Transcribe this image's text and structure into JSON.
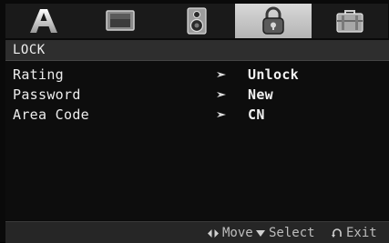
{
  "tabs": [
    {
      "icon": "language-a-icon",
      "active": false
    },
    {
      "icon": "display-icon",
      "active": false
    },
    {
      "icon": "speaker-icon",
      "active": false
    },
    {
      "icon": "lock-icon",
      "active": true
    },
    {
      "icon": "briefcase-icon",
      "active": false
    }
  ],
  "header": {
    "title": "LOCK"
  },
  "menu": {
    "items": [
      {
        "label": "Rating",
        "value": "Unlock"
      },
      {
        "label": "Password",
        "value": "New"
      },
      {
        "label": "Area Code",
        "value": "CN"
      }
    ]
  },
  "footer": {
    "move": "Move",
    "select": "Select",
    "exit": "Exit"
  },
  "colors": {
    "background": "#0a0a0a",
    "active_tab": "#c8c8c8",
    "header_bar": "#2e2e2e",
    "footer_bar": "#262626"
  }
}
